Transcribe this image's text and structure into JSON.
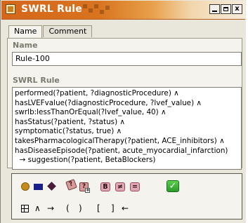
{
  "window": {
    "title": "SWRL Rule",
    "buttons": {
      "minimize": "",
      "maximize": "",
      "close": "x"
    }
  },
  "tabs": [
    {
      "label": "Name",
      "active": true
    },
    {
      "label": "Comment",
      "active": false
    }
  ],
  "name_section": {
    "label": "Name",
    "value": "Rule-100"
  },
  "rule_section": {
    "label": "SWRL Rule",
    "lines": [
      "performed(?patient, ?diagnosticProcedure)  ∧",
      "hasLVEFvalue(?diagnosticProcedure, ?lvef_value)  ∧",
      "swrlb:lessThanOrEqual(?lvef_value, 40)  ∧",
      "hasStatus(?patient, ?status)  ∧",
      "symptomatic(?status, true)  ∧",
      "takesPharmacologicalTherapy(?patient, ACE_inhibitors)  ∧",
      "hasDiseaseEpisode(?patient, acute_myocardial_infarction)",
      "  → suggestion(?patient, BetaBlockers)"
    ]
  },
  "toolbar": {
    "row1": {
      "class_icon": "class-circle-icon",
      "property_icon": "property-rect-icon",
      "individual_icon": "individual-diamond-icon",
      "variable_label": "?",
      "variable_plus_label": "?",
      "builtin_label": "B",
      "different_from_label": "≠",
      "same_as_label": "=",
      "check_label": "✓"
    },
    "row2": {
      "grid_icon": "grid-icon",
      "and_label": "∧",
      "implies_label": "→",
      "lparen_label": "(",
      "rparen_label": ")",
      "lbracket_label": "[",
      "rbracket_label": "]",
      "backspace_label": "←"
    }
  },
  "colors": {
    "title_bar_start": "#d6661a",
    "title_bar_end": "#f6ecdc",
    "window_bg": "#e9e6dc",
    "section_label": "#7d7a6e",
    "class_circle": "#c48a1a",
    "property_rect": "#1a1f8c",
    "individual_diamond": "#4a1a3a",
    "check_green": "#2b9a2a"
  }
}
